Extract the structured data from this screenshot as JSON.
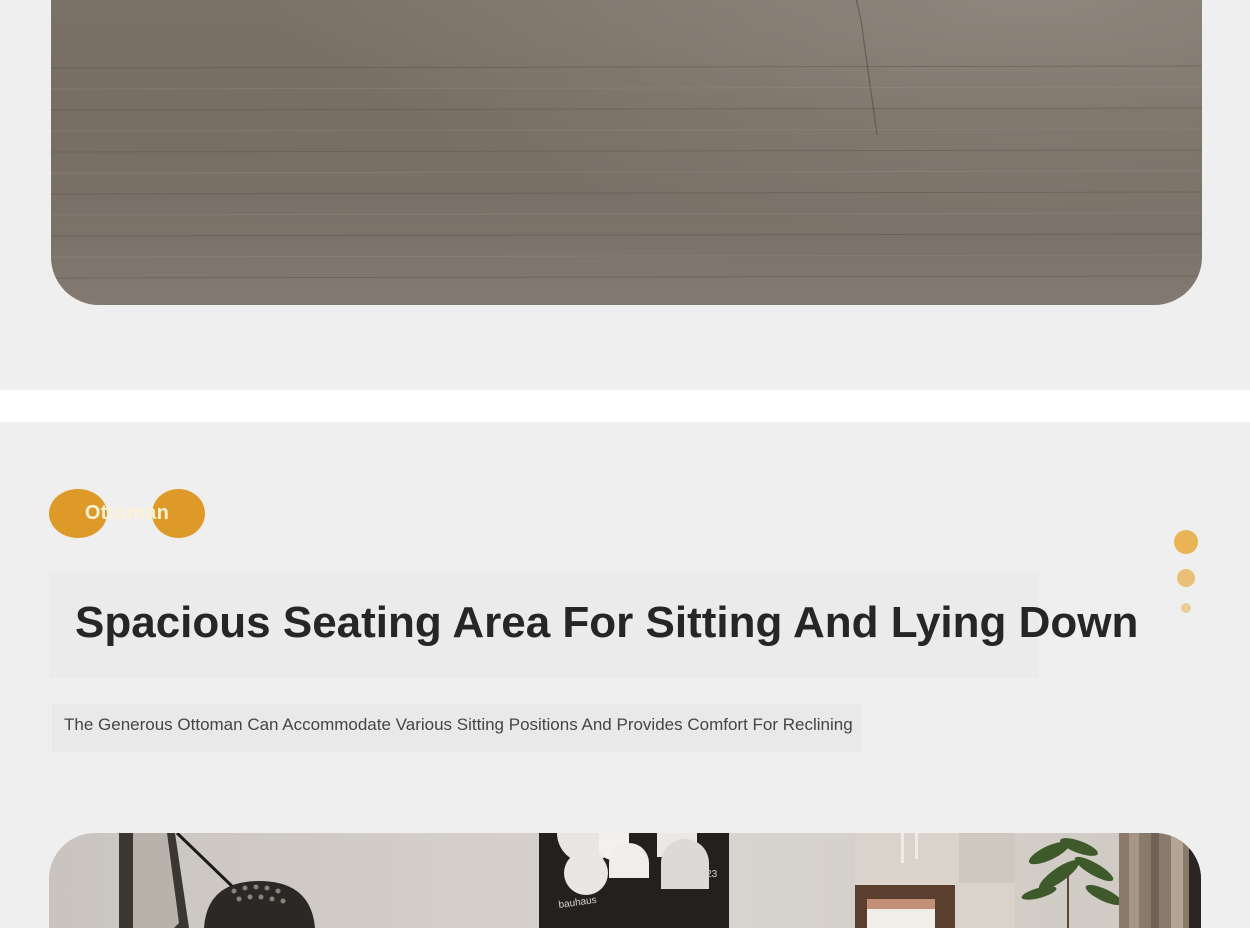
{
  "feature": {
    "tag_label": "Ottoman",
    "headline": "Spacious Seating Area For Sitting And Lying Down",
    "description": "The Generous Ottoman Can Accommodate Various Sitting Positions And Provides Comfort For Reclining"
  },
  "images": {
    "fabric_image": "fabric-texture-closeup",
    "room_image": "living-room-with-ottoman"
  },
  "room_scene": {
    "poster_brand": "bauhaus",
    "poster_year": "1923"
  },
  "pagination": {
    "count": 3,
    "active_index": 0
  },
  "colors": {
    "background": "#efefef",
    "accent": "#dd9a28",
    "heading": "#262626",
    "body_text": "#454545",
    "separator": "#ffffff"
  }
}
